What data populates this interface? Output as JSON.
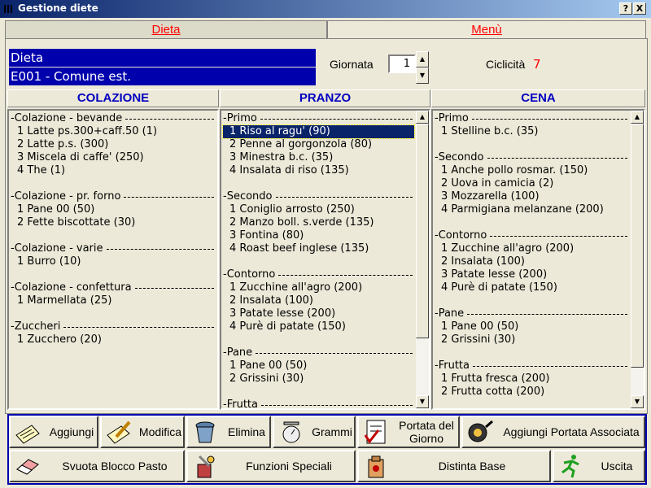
{
  "window": {
    "title": "Gestione diete",
    "help_btn": "?",
    "close_btn": "X"
  },
  "tabs": [
    {
      "label": "Dieta"
    },
    {
      "label": "Menù"
    }
  ],
  "header": {
    "dieta_label": "Dieta",
    "dieta_code": "E001 - Comune est.",
    "giornata_label": "Giornata",
    "giornata_value": "1",
    "ciclicita_label": "Ciclicità",
    "ciclicita_value": "7"
  },
  "columns": [
    {
      "title": "COLAZIONE",
      "rows": [
        {
          "type": "sec",
          "text": "Colazione - bevande"
        },
        {
          "type": "item",
          "text": "1 Latte ps.300+caff.50   (1)"
        },
        {
          "type": "item",
          "text": "2 Latte p.s.   (300)"
        },
        {
          "type": "item",
          "text": "3 Miscela di caffe'   (250)"
        },
        {
          "type": "item",
          "text": "4 The   (1)"
        },
        {
          "type": "blank",
          "text": ""
        },
        {
          "type": "sec",
          "text": "Colazione - pr. forno"
        },
        {
          "type": "item",
          "text": "1 Pane 00   (50)"
        },
        {
          "type": "item",
          "text": "2 Fette biscottate   (30)"
        },
        {
          "type": "blank",
          "text": ""
        },
        {
          "type": "sec",
          "text": "Colazione - varie"
        },
        {
          "type": "item",
          "text": "1 Burro   (10)"
        },
        {
          "type": "blank",
          "text": ""
        },
        {
          "type": "sec",
          "text": "Colazione - confettura"
        },
        {
          "type": "item",
          "text": "1 Marmellata   (25)"
        },
        {
          "type": "blank",
          "text": ""
        },
        {
          "type": "sec",
          "text": "Zuccheri"
        },
        {
          "type": "item",
          "text": "1 Zucchero   (20)"
        }
      ]
    },
    {
      "title": "PRANZO",
      "rows": [
        {
          "type": "sec",
          "text": "Primo"
        },
        {
          "type": "item",
          "text": "1 Riso al ragu'   (90)",
          "selected": true
        },
        {
          "type": "item",
          "text": "2 Penne al gorgonzola   (80)"
        },
        {
          "type": "item",
          "text": "3 Minestra b.c.   (35)"
        },
        {
          "type": "item",
          "text": "4 Insalata di riso   (135)"
        },
        {
          "type": "blank",
          "text": ""
        },
        {
          "type": "sec",
          "text": "Secondo"
        },
        {
          "type": "item",
          "text": "1 Coniglio arrosto   (250)"
        },
        {
          "type": "item",
          "text": "2 Manzo boll. s.verde   (135)"
        },
        {
          "type": "item",
          "text": "3 Fontina   (80)"
        },
        {
          "type": "item",
          "text": "4 Roast beef inglese   (135)"
        },
        {
          "type": "blank",
          "text": ""
        },
        {
          "type": "sec",
          "text": "Contorno"
        },
        {
          "type": "item",
          "text": "1 Zucchine all'agro   (200)"
        },
        {
          "type": "item",
          "text": "2 Insalata   (100)"
        },
        {
          "type": "item",
          "text": "3 Patate lesse   (200)"
        },
        {
          "type": "item",
          "text": "4 Purè di patate   (150)"
        },
        {
          "type": "blank",
          "text": ""
        },
        {
          "type": "sec",
          "text": "Pane"
        },
        {
          "type": "item",
          "text": "1 Pane 00   (50)"
        },
        {
          "type": "item",
          "text": "2 Grissini   (30)"
        },
        {
          "type": "blank",
          "text": ""
        },
        {
          "type": "sec",
          "text": "Frutta"
        }
      ]
    },
    {
      "title": "CENA",
      "rows": [
        {
          "type": "sec",
          "text": "Primo"
        },
        {
          "type": "item",
          "text": "1 Stelline b.c.   (35)"
        },
        {
          "type": "blank",
          "text": ""
        },
        {
          "type": "sec",
          "text": "Secondo"
        },
        {
          "type": "item",
          "text": "1 Anche pollo rosmar.   (150)"
        },
        {
          "type": "item",
          "text": "2 Uova in camicia   (2)"
        },
        {
          "type": "item",
          "text": "3 Mozzarella   (100)"
        },
        {
          "type": "item",
          "text": "4 Parmigiana melanzane   (200)"
        },
        {
          "type": "blank",
          "text": ""
        },
        {
          "type": "sec",
          "text": "Contorno"
        },
        {
          "type": "item",
          "text": "1 Zucchine all'agro   (200)"
        },
        {
          "type": "item",
          "text": "2 Insalata   (100)"
        },
        {
          "type": "item",
          "text": "3 Patate lesse   (200)"
        },
        {
          "type": "item",
          "text": "4 Purè di patate   (150)"
        },
        {
          "type": "blank",
          "text": ""
        },
        {
          "type": "sec",
          "text": "Pane"
        },
        {
          "type": "item",
          "text": "1 Pane 00   (50)"
        },
        {
          "type": "item",
          "text": "2 Grissini   (30)"
        },
        {
          "type": "blank",
          "text": ""
        },
        {
          "type": "sec",
          "text": "Frutta"
        },
        {
          "type": "item",
          "text": "1 Frutta fresca   (200)"
        },
        {
          "type": "item",
          "text": "2 Frutta cotta   (200)"
        }
      ]
    }
  ],
  "buttons": {
    "aggiungi": "Aggiungi",
    "modifica": "Modifica",
    "elimina": "Elimina",
    "grammi": "Grammi",
    "portata_line1": "Portata del",
    "portata_line2": "Giorno",
    "aggiungi_portata": "Aggiungi Portata Associata",
    "svuota": "Svuota Blocco Pasto",
    "funzioni": "Funzioni Speciali",
    "distinta": "Distinta Base",
    "uscita": "Uscita"
  },
  "icons": {
    "aggiungi": "notepad-icon",
    "modifica": "pencil-icon",
    "elimina": "trash-can-icon",
    "grammi": "scale-icon",
    "portata": "checklist-icon",
    "aggiungi_portata": "frying-pan-icon",
    "svuota": "eraser-icon",
    "funzioni": "tools-icon",
    "distinta": "bag-icon",
    "uscita": "running-man-icon"
  }
}
